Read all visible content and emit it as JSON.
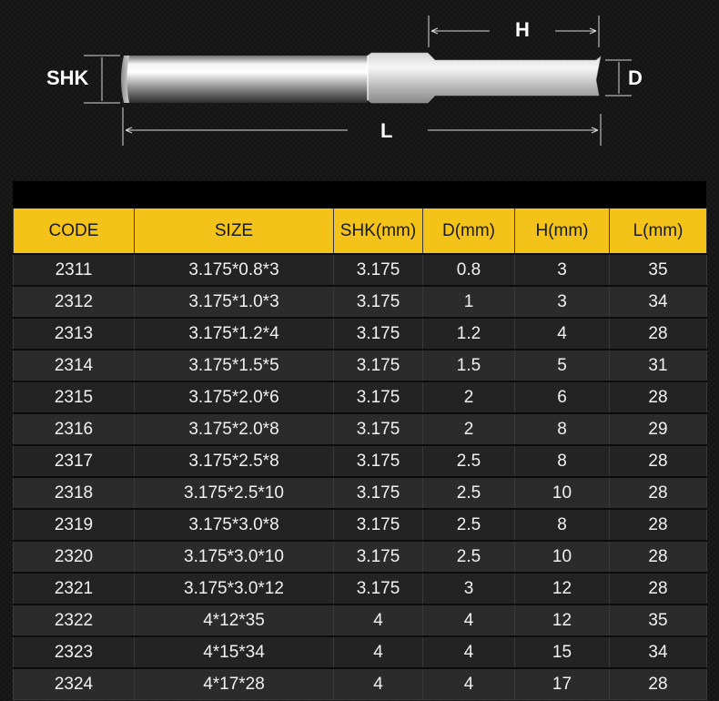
{
  "diagram": {
    "labels": {
      "shank": "SHK",
      "head_length": "H",
      "diameter": "D",
      "total_length": "L"
    }
  },
  "table": {
    "headers": [
      "CODE",
      "SIZE",
      "SHK(mm)",
      "D(mm)",
      "H(mm)",
      "L(mm)"
    ],
    "rows": [
      [
        "2311",
        "3.175*0.8*3",
        "3.175",
        "0.8",
        "3",
        "35"
      ],
      [
        "2312",
        "3.175*1.0*3",
        "3.175",
        "1",
        "3",
        "34"
      ],
      [
        "2313",
        "3.175*1.2*4",
        "3.175",
        "1.2",
        "4",
        "28"
      ],
      [
        "2314",
        "3.175*1.5*5",
        "3.175",
        "1.5",
        "5",
        "31"
      ],
      [
        "2315",
        "3.175*2.0*6",
        "3.175",
        "2",
        "6",
        "28"
      ],
      [
        "2316",
        "3.175*2.0*8",
        "3.175",
        "2",
        "8",
        "29"
      ],
      [
        "2317",
        "3.175*2.5*8",
        "3.175",
        "2.5",
        "8",
        "28"
      ],
      [
        "2318",
        "3.175*2.5*10",
        "3.175",
        "2.5",
        "10",
        "28"
      ],
      [
        "2319",
        "3.175*3.0*8",
        "3.175",
        "2.5",
        "8",
        "28"
      ],
      [
        "2320",
        "3.175*3.0*10",
        "3.175",
        "2.5",
        "10",
        "28"
      ],
      [
        "2321",
        "3.175*3.0*12",
        "3.175",
        "3",
        "12",
        "28"
      ],
      [
        "2322",
        "4*12*35",
        "4",
        "4",
        "12",
        "35"
      ],
      [
        "2323",
        "4*15*34",
        "4",
        "4",
        "15",
        "34"
      ],
      [
        "2324",
        "4*17*28",
        "4",
        "4",
        "17",
        "28"
      ]
    ]
  },
  "colors": {
    "header_bg": "#f3c31a",
    "header_text": "#1a1a1a",
    "cell_text": "#f2f2f2",
    "background": "#141414"
  }
}
